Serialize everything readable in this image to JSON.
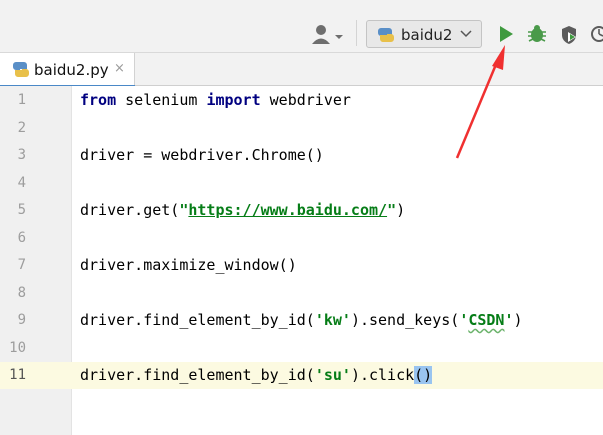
{
  "toolbar": {
    "user_icon": "user-icon",
    "run_config": {
      "name": "baidu2",
      "icon": "python-icon"
    },
    "run_icon": "play-icon",
    "debug_icon": "bug-icon",
    "coverage_icon": "shield-run-icon",
    "profile_icon": "profiler-icon",
    "colors": {
      "run": "#3f9a3f",
      "debug": "#4a9a4a",
      "accent": "#4a88c7"
    }
  },
  "editor_tab": {
    "label": "baidu2.py",
    "close": "×"
  },
  "lines": [
    {
      "n": "1",
      "parts": [
        [
          "kw",
          "from"
        ],
        [
          "",
          " selenium "
        ],
        [
          "kw",
          "import"
        ],
        [
          "",
          " webdriver"
        ]
      ]
    },
    {
      "n": "2",
      "parts": []
    },
    {
      "n": "3",
      "parts": [
        [
          "",
          "driver = webdriver.Chrome()"
        ]
      ]
    },
    {
      "n": "4",
      "parts": []
    },
    {
      "n": "5",
      "parts": [
        [
          "",
          "driver.get("
        ],
        [
          "str",
          "\""
        ],
        [
          "str url",
          "https://www.baidu.com/"
        ],
        [
          "str",
          "\""
        ],
        [
          "",
          ")"
        ]
      ]
    },
    {
      "n": "6",
      "parts": []
    },
    {
      "n": "7",
      "parts": [
        [
          "",
          "driver.maximize_window()"
        ]
      ]
    },
    {
      "n": "8",
      "parts": []
    },
    {
      "n": "9",
      "parts": [
        [
          "",
          "driver.find_element_by_id("
        ],
        [
          "str",
          "'kw'"
        ],
        [
          "",
          ").send_keys("
        ],
        [
          "str",
          "'"
        ],
        [
          "str squig",
          "CSDN"
        ],
        [
          "str",
          "'"
        ],
        [
          "",
          ")"
        ]
      ]
    },
    {
      "n": "10",
      "parts": []
    },
    {
      "n": "11",
      "parts": [
        [
          "",
          "driver.find_element_by_id("
        ],
        [
          "str",
          "'su'"
        ],
        [
          "",
          ").click"
        ],
        [
          "brace-hl",
          "()"
        ]
      ],
      "current": true
    }
  ]
}
